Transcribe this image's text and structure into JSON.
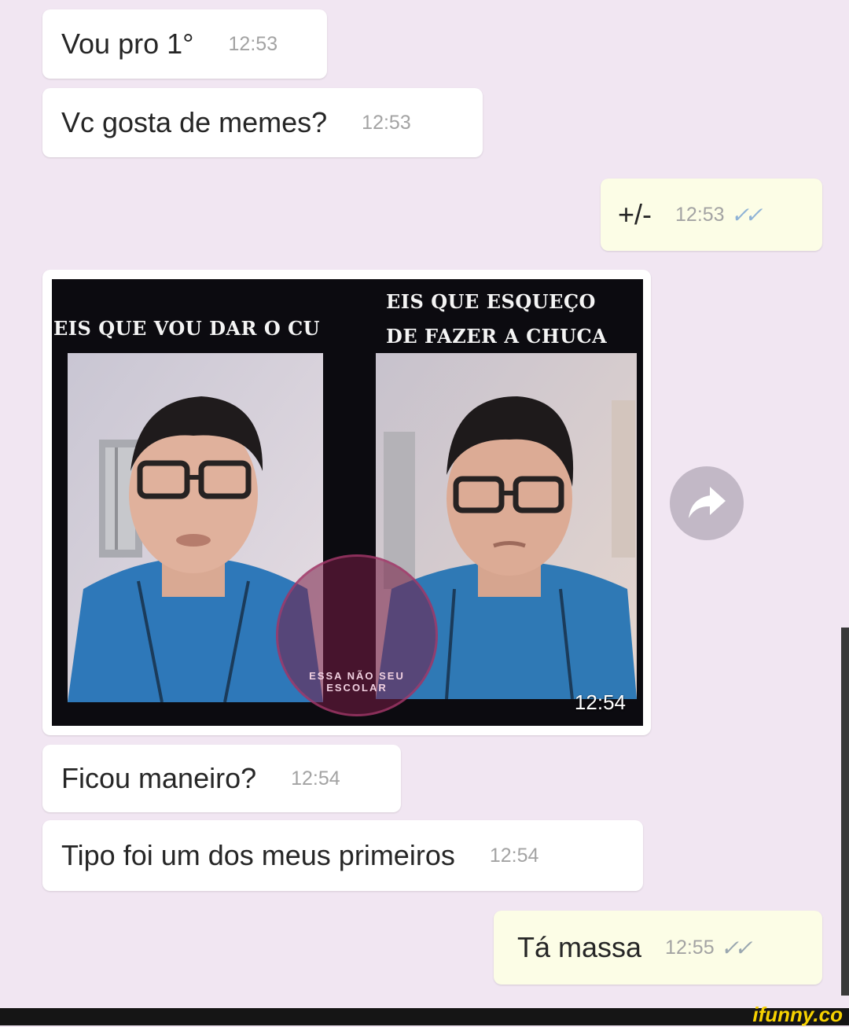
{
  "messages": [
    {
      "text": "Vou pro 1°",
      "time": "12:53"
    },
    {
      "text": "Vc gosta de memes?",
      "time": "12:53"
    },
    {
      "text": "+/-",
      "time": "12:53",
      "ticks": "✓✓"
    },
    {
      "text": "Ficou maneiro?",
      "time": "12:54"
    },
    {
      "text": "Tipo foi um dos meus primeiros",
      "time": "12:54"
    },
    {
      "text": "Tá massa",
      "time": "12:55",
      "ticks": "✓✓"
    }
  ],
  "image_message": {
    "caption_left": "EIS QUE VOU DAR O CU",
    "caption_right_line1": "EIS QUE ESQUEÇO",
    "caption_right_line2": "DE FAZER A CHUCA",
    "time": "12:54",
    "watermark": "ESSA NÃO SEU ESCOLAR"
  },
  "share_icon": "share-arrow-icon",
  "footer": {
    "logo": "ifunny.co"
  },
  "colors": {
    "background": "#f1e6f2",
    "incoming": "#ffffff",
    "outgoing": "#fcfde6",
    "ticks": "#8fb3d6"
  }
}
